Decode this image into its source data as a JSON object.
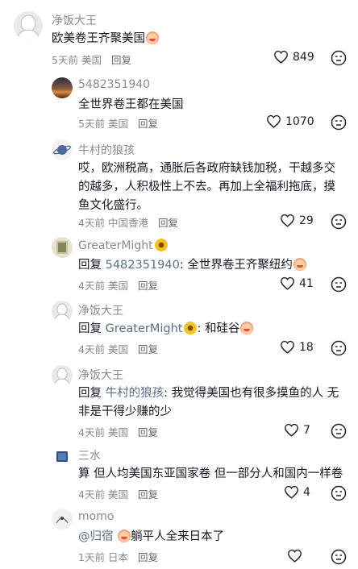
{
  "comments": [
    {
      "name": "净饭大王",
      "text": "欧美卷王齐聚美国",
      "time": "5天前",
      "loc": "美国",
      "reply": "回复",
      "likes": "849"
    },
    {
      "name": "5482351940",
      "text": "全世界卷王都在美国",
      "time": "5天前",
      "loc": "美国",
      "reply": "回复",
      "likes": "1070"
    },
    {
      "name": "牛村的狼孩",
      "text": "哎，欧洲税高，通胀后各政府缺钱加税，干越多交的越多，人积极性上不去。再加上全福利拖底，摸鱼文化盛行。",
      "time": "4天前",
      "loc": "中国香港",
      "reply": "回复",
      "likes": "29"
    },
    {
      "name": "GreaterMight",
      "prefix": "回复",
      "mention": "5482351940",
      "text": ": 全世界卷王齐聚纽约",
      "time": "4天前",
      "loc": "美国",
      "reply": "回复",
      "likes": "41"
    },
    {
      "name": "净饭大王",
      "prefix": "回复",
      "mention": "GreaterMight",
      "text": ": 和硅谷",
      "time": "4天前",
      "loc": "美国",
      "reply": "回复",
      "likes": "18"
    },
    {
      "name": "净饭大王",
      "prefix": "回复",
      "mention": "牛村的狼孩",
      "text": ": 我觉得美国也有很多摸鱼的人 无非是干得少赚的少",
      "time": "4天前",
      "loc": "美国",
      "reply": "回复",
      "likes": "7"
    },
    {
      "name": "三水",
      "text": "算 但人均美国东亚国家卷 但一部分人和国内一样卷",
      "time": "4天前",
      "loc": "美国",
      "reply": "回复",
      "likes": "4"
    },
    {
      "name": "momo",
      "mention": "@归宿",
      "text": "躺平人全来日本了",
      "time": "1天前",
      "loc": "日本",
      "reply": "回复",
      "likes": ""
    }
  ],
  "icons": {
    "like": "heart-outline-icon",
    "dislike": "unamused-face-icon"
  }
}
